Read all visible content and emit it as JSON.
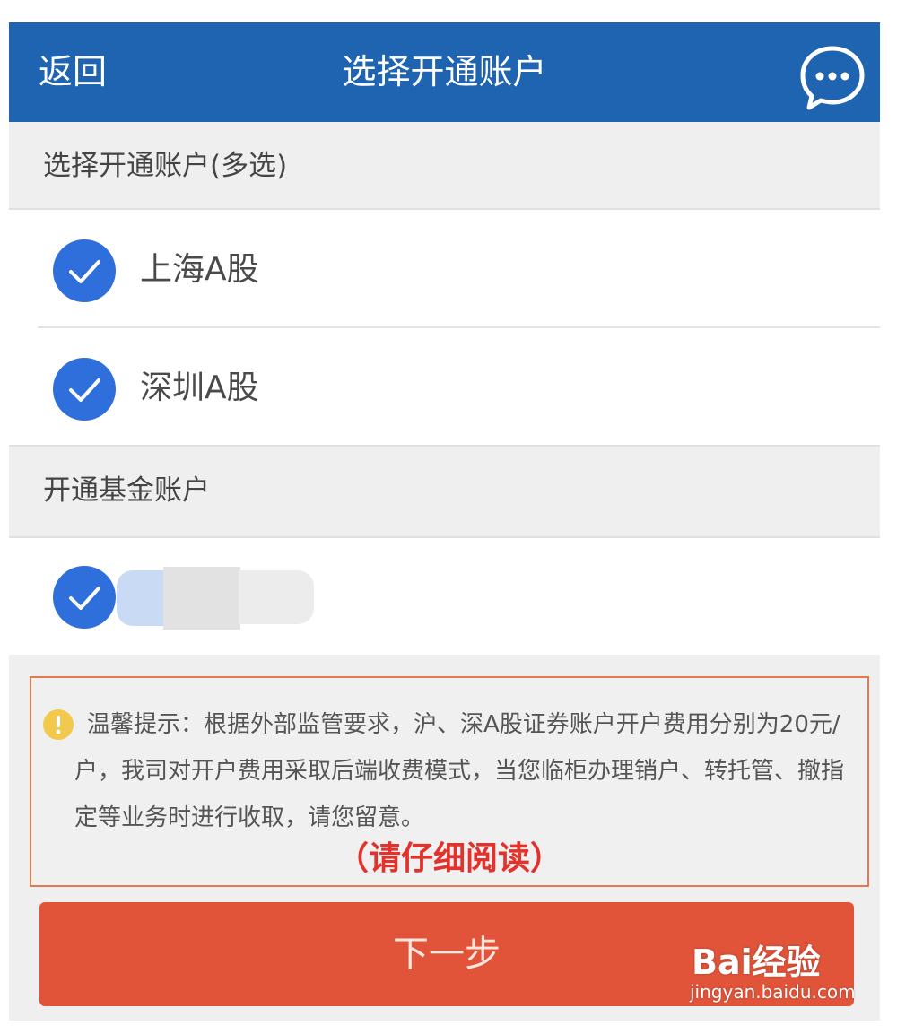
{
  "header": {
    "back_label": "返回",
    "title": "选择开通账户",
    "chat_icon": "chat-bubble-icon"
  },
  "sections": [
    {
      "title": "选择开通账户(多选)",
      "items": [
        {
          "label": "上海A股",
          "checked": true
        },
        {
          "label": "深圳A股",
          "checked": true
        }
      ]
    },
    {
      "title": "开通基金账户",
      "items": [
        {
          "label": "",
          "checked": true,
          "obscured": true
        }
      ]
    }
  ],
  "notice": {
    "icon": "warning-icon",
    "text": "温馨提示：根据外部监管要求，沪、深A股证券账户开户费用分别为20元/户，我司对开户费用采取后端收费模式，当您临柜办理销户、转托管、撤指定等业务时进行收取，请您留意。",
    "emphasis": "（请仔细阅读）"
  },
  "next_button": {
    "label": "下一步"
  },
  "watermark": {
    "logo": "Bai经验",
    "url": "jingyan.baidu.com"
  },
  "colors": {
    "header_bg": "#1f64b1",
    "check_blue": "#2f6fdc",
    "button_bg": "#e2543a",
    "notice_border": "#e27a4d",
    "emphasis_red": "#e2322b"
  }
}
